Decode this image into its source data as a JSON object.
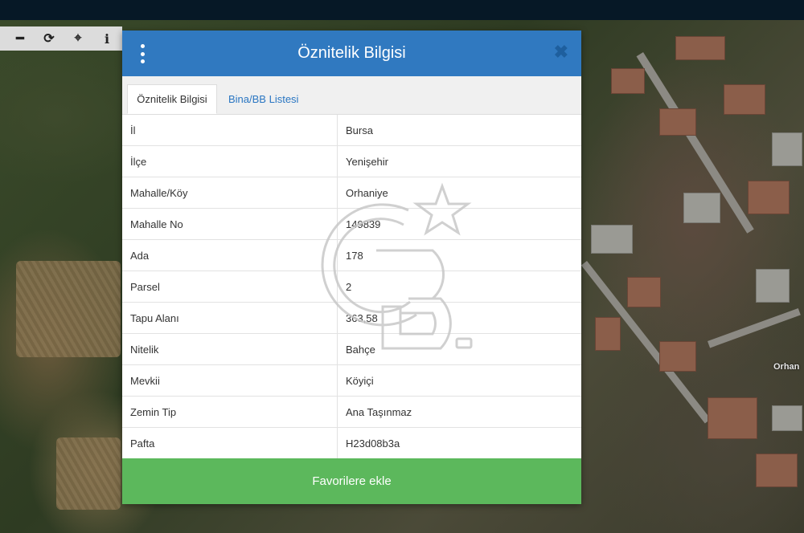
{
  "map": {
    "place_label": "Orhan"
  },
  "toolbar": {
    "icons": [
      "minus-icon",
      "refresh-icon",
      "crosshair-icon",
      "info-icon"
    ],
    "glyphs": [
      "━",
      "⟳",
      "⌖",
      "i"
    ]
  },
  "modal": {
    "title": "Öznitelik Bilgisi",
    "close_glyph": "✖",
    "tabs": [
      {
        "label": "Öznitelik Bilgisi",
        "active": true
      },
      {
        "label": "Bina/BB Listesi",
        "active": false
      }
    ],
    "rows": [
      {
        "key": "İl",
        "value": "Bursa"
      },
      {
        "key": "İlçe",
        "value": "Yenişehir"
      },
      {
        "key": "Mahalle/Köy",
        "value": "Orhaniye"
      },
      {
        "key": "Mahalle No",
        "value": "149839"
      },
      {
        "key": "Ada",
        "value": "178"
      },
      {
        "key": "Parsel",
        "value": "2"
      },
      {
        "key": "Tapu Alanı",
        "value": "363,58"
      },
      {
        "key": "Nitelik",
        "value": "Bahçe"
      },
      {
        "key": "Mevkii",
        "value": "Köyiçi"
      },
      {
        "key": "Zemin Tip",
        "value": "Ana Taşınmaz"
      },
      {
        "key": "Pafta",
        "value": "H23d08b3a"
      }
    ],
    "favorite_button": "Favorilere ekle"
  },
  "colors": {
    "header": "#3079c0",
    "button": "#5cb85c",
    "link": "#2a76c2"
  }
}
